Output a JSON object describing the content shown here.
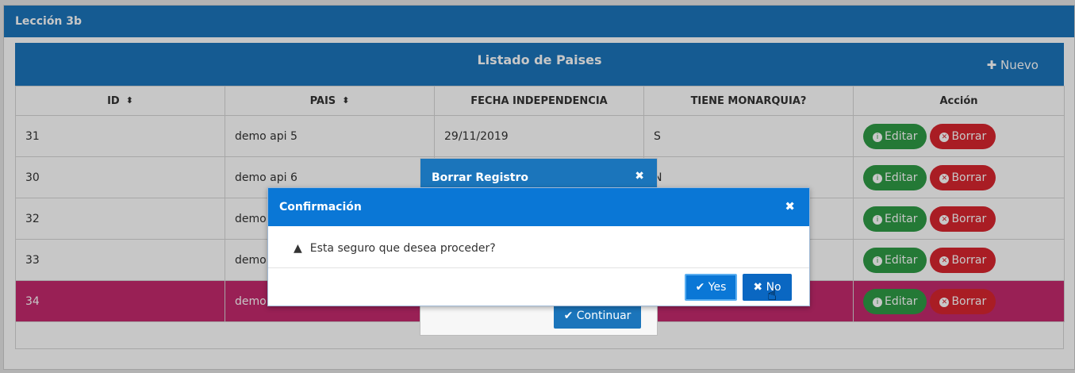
{
  "panel": {
    "title": "Lección 3b"
  },
  "table": {
    "title": "Listado de Paises",
    "new_label": "✚ Nuevo",
    "columns": [
      "ID",
      "PAIS",
      "FECHA INDEPENDENCIA",
      "TIENE MONARQUIA?",
      "Acción"
    ],
    "sort_icon": "⬍",
    "rows": [
      {
        "id": "31",
        "pais": "demo api 5",
        "fecha": "29/11/2019",
        "monarquia": "S"
      },
      {
        "id": "30",
        "pais": "demo api 6",
        "fecha": "",
        "monarquia": "N"
      },
      {
        "id": "32",
        "pais": "demo api",
        "fecha": "",
        "monarquia": ""
      },
      {
        "id": "33",
        "pais": "demo",
        "fecha": "",
        "monarquia": ""
      },
      {
        "id": "34",
        "pais": "demo",
        "fecha": "",
        "monarquia": ""
      }
    ],
    "edit_label": "Editar",
    "delete_label": "Borrar",
    "info_icon": "i",
    "close_icon": "✕"
  },
  "dialog_borrar": {
    "title": "Borrar Registro",
    "close": "✖",
    "continue_label": "✔ Continuar"
  },
  "dialog_confirm": {
    "title": "Confirmación",
    "close": "✖",
    "warning_icon": "▲",
    "message": "Esta seguro que desea proceder?",
    "yes_label": "✔ Yes",
    "no_label": "✖ No"
  },
  "colors": {
    "primary": "#1b75bb",
    "selected_row": "#c42a6d",
    "edit": "#2f9c46",
    "delete": "#d9262f"
  }
}
